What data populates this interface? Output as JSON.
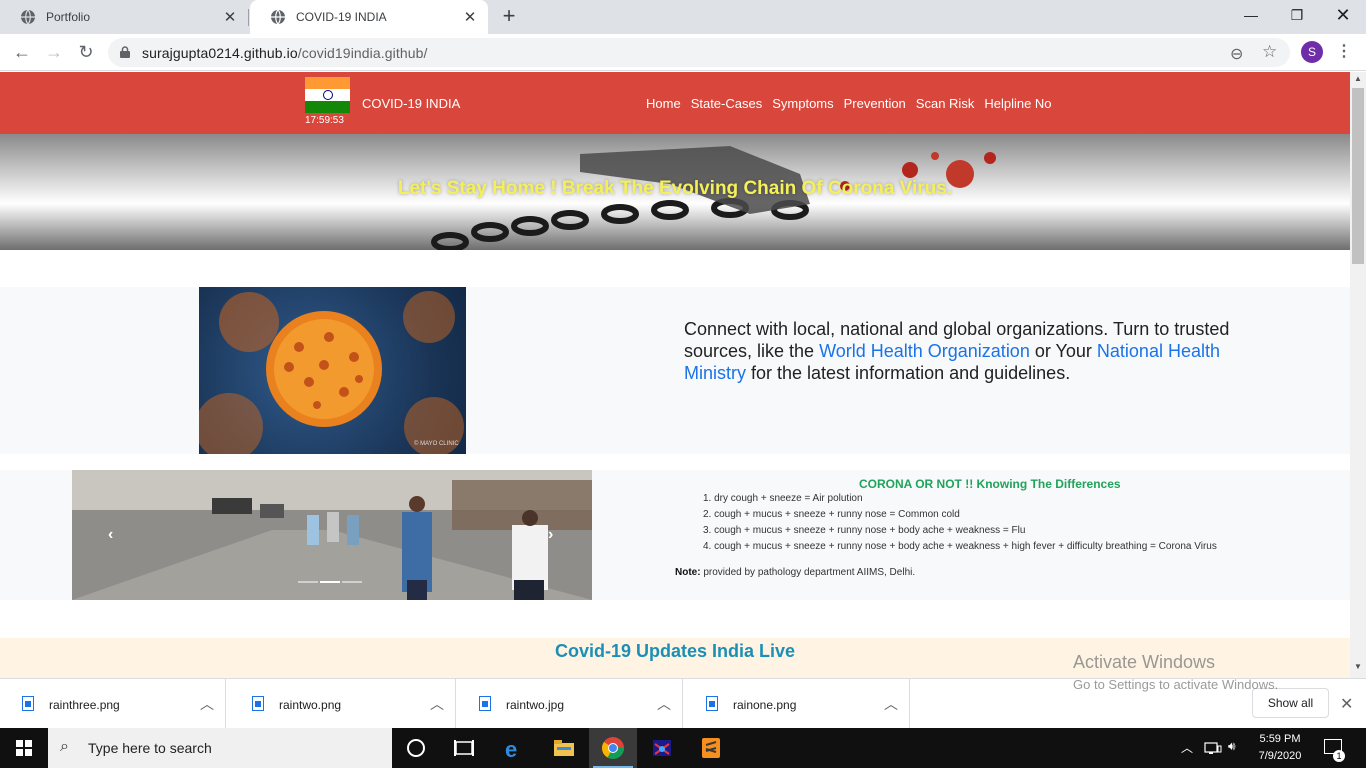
{
  "browser": {
    "tabs": [
      {
        "title": "Portfolio",
        "active": false
      },
      {
        "title": "COVID-19 INDIA",
        "active": true
      }
    ],
    "url_host": "surajgupta0214.github.io",
    "url_path": "/covid19india.github/",
    "profile_initial": "S"
  },
  "site": {
    "clock": "17:59:53",
    "brand": "COVID-19 INDIA",
    "menu": [
      "Home",
      "State-Cases",
      "Symptoms",
      "Prevention",
      "Scan Risk",
      "Helpline No"
    ],
    "hero_text": "Let's Stay Home ! Break The Evolving Chain Of Corona Virus.",
    "info": {
      "part1": "Connect with local, national and global organizations. Turn to trusted sources, like the ",
      "link1": "World Health Organization",
      "part2": " or Your ",
      "link2": "National Health Ministry",
      "part3": " for the latest information and guidelines."
    },
    "virus_caption": "© MAYO CLINIC",
    "differences": {
      "title": "CORONA OR NOT !! Knowing The Differences",
      "items": [
        "dry cough + sneeze = Air polution",
        "cough + mucus + sneeze + runny nose = Common cold",
        "cough + mucus + sneeze + runny nose + body ache + weakness = Flu",
        "cough + mucus + sneeze + runny nose + body ache + weakness + high fever + difficulty breathing = Corona Virus"
      ],
      "item_numbers": [
        "1.",
        "2.",
        "3.",
        "4."
      ],
      "note_label": "Note:",
      "note_text": " provided by pathology department AIIMS, Delhi."
    },
    "updates_title": "Covid-19 Updates India Live"
  },
  "downloads": {
    "items": [
      "rainthree.png",
      "raintwo.png",
      "raintwo.jpg",
      "rainone.png"
    ],
    "show_all": "Show all"
  },
  "watermark": {
    "line1": "Activate Windows",
    "line2": "Go to Settings to activate Windows."
  },
  "taskbar": {
    "search_placeholder": "Type here to search",
    "time": "5:59 PM",
    "date": "7/9/2020",
    "notification_count": "1"
  },
  "colors": {
    "nav_red": "#d9473c",
    "hero_text_yellow": "#f5f05a",
    "link_blue": "#1a73e8",
    "diff_title_green": "#20a35a",
    "updates_teal": "#1b8fb5"
  }
}
